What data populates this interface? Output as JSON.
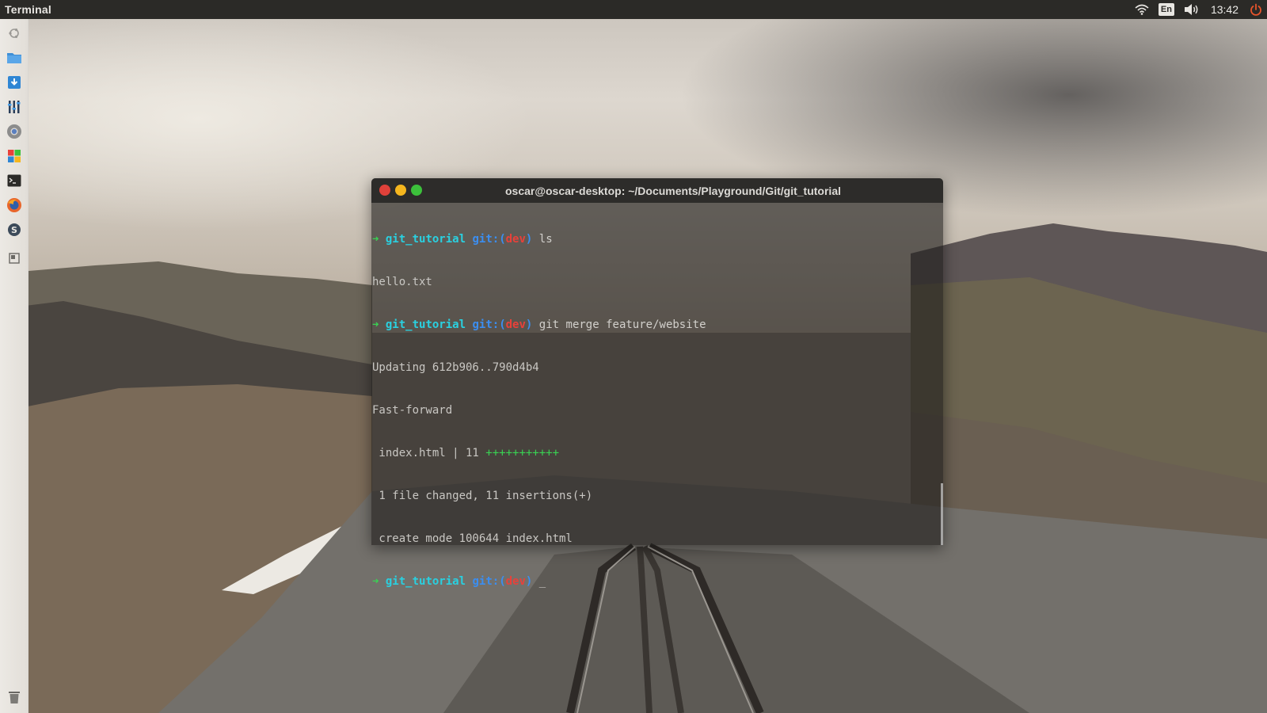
{
  "top_panel": {
    "app_title": "Terminal",
    "lang": "En",
    "clock": "13:42",
    "icons": [
      "wifi-icon",
      "volume-icon",
      "power-icon"
    ],
    "colors": {
      "power": "#e8542b"
    }
  },
  "launcher": {
    "items": [
      {
        "name": "launcher-dash",
        "icon": "ubuntu-logo-icon"
      },
      {
        "name": "launcher-files",
        "icon": "folder-icon"
      },
      {
        "name": "launcher-downloads",
        "icon": "download-icon"
      },
      {
        "name": "launcher-mixer",
        "icon": "equalizer-icon"
      },
      {
        "name": "launcher-chrome",
        "icon": "chrome-icon"
      },
      {
        "name": "launcher-apps",
        "icon": "app-grid-icon"
      },
      {
        "name": "launcher-terminal",
        "icon": "terminal-icon"
      },
      {
        "name": "launcher-firefox",
        "icon": "firefox-icon"
      },
      {
        "name": "launcher-skype",
        "icon": "skype-icon"
      },
      {
        "name": "launcher-workspaces",
        "icon": "workspace-icon"
      },
      {
        "name": "launcher-trash",
        "icon": "trash-icon"
      }
    ]
  },
  "terminal": {
    "title": "oscar@oscar-desktop: ~/Documents/Playground/Git/git_tutorial",
    "prompt": {
      "arrow": "➜",
      "dir": "git_tutorial",
      "git_label": "git:",
      "paren_open": "(",
      "branch": "dev",
      "paren_close": ")"
    },
    "lines": {
      "cmd1": "ls",
      "out1": "hello.txt",
      "cmd2": "git merge feature/website",
      "out2": "Updating 612b906..790d4b4",
      "out3": "Fast-forward",
      "out4_file": " index.html | 11 ",
      "out4_plus": "+++++++++++",
      "out5": " 1 file changed, 11 insertions(+)",
      "out6": " create mode 100644 index.html",
      "cursor": "_"
    },
    "colors": {
      "arrow": "#39d353",
      "dir": "#2ad0e0",
      "git": "#3b8ef0",
      "branch": "#e8413a",
      "close": "#e0413a",
      "minimize": "#f5b61e",
      "maximize": "#3cc13b"
    }
  }
}
